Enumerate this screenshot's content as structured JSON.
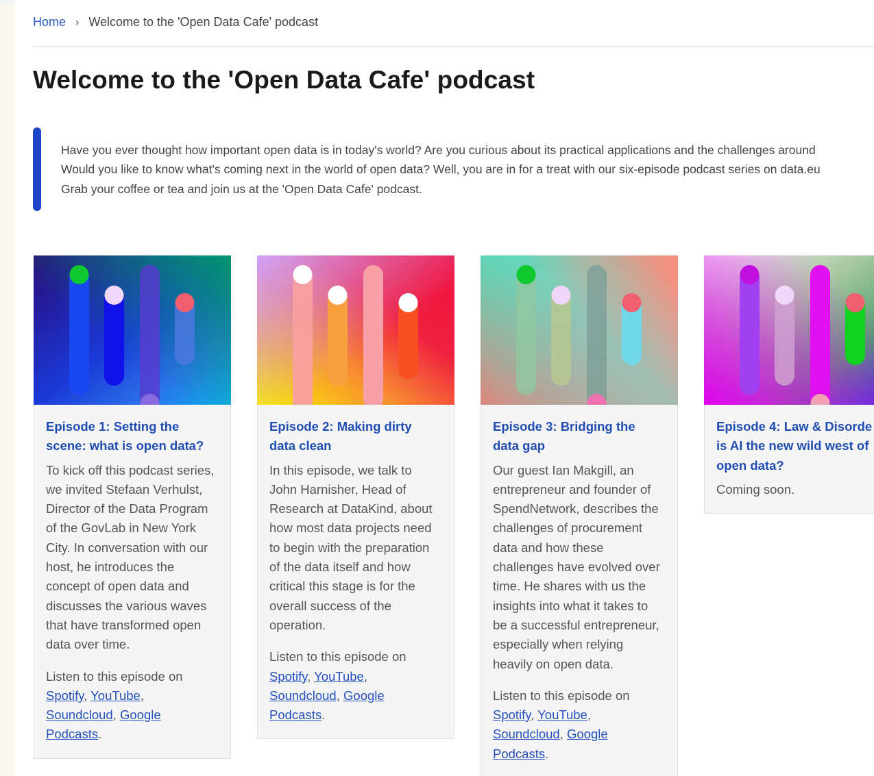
{
  "breadcrumb": {
    "home": "Home",
    "separator": "›",
    "current": "Welcome to the 'Open Data Cafe' podcast"
  },
  "page_title": "Welcome to the 'Open Data Cafe' podcast",
  "intro": {
    "lines": [
      "Have you ever thought how important open data is in today's world? Are you curious about its practical applications and the challenges around",
      "Would you like to know what's coming next in the world of open data? Well, you are in for a treat with our six-episode podcast series on data.eu",
      "Grab your coffee or tea and join us at the 'Open Data Cafe' podcast."
    ]
  },
  "cards": [
    {
      "title_lines": [
        "Episode 1: Setting the",
        "scene: what is open data?"
      ],
      "desc_lines": [
        "To kick off this podcast series,",
        "we invited Stefaan Verhulst,",
        "Director of the Data Program",
        "of the GovLab in New York",
        "City. In conversation with our",
        "host, he introduces the",
        "concept of open data and",
        "discusses the various waves",
        "that have transformed open",
        "data over time."
      ],
      "listen_label": "Listen to this episode on",
      "links": {
        "spotify": "Spotify",
        "youtube": "YouTube",
        "soundcloud": "Soundcloud",
        "google": "Google",
        "podcasts": "Podcasts"
      }
    },
    {
      "title_lines": [
        "Episode 2: Making dirty",
        "data clean"
      ],
      "desc_lines": [
        "In this episode, we talk to",
        "John Harnisher, Head of",
        "Research at DataKind, about",
        "how most data projects need",
        "to begin with the preparation",
        "of the data itself and how",
        "critical this stage is for the",
        "overall success of the",
        "operation."
      ],
      "listen_label": "Listen to this episode on",
      "links": {
        "spotify": "Spotify",
        "youtube": "YouTube",
        "soundcloud": "Soundcloud",
        "google": "Google",
        "podcasts": "Podcasts"
      }
    },
    {
      "title_lines": [
        "Episode 3: Bridging the",
        "data gap"
      ],
      "desc_lines": [
        "Our guest Ian Makgill, an",
        "entrepreneur and founder of",
        "SpendNetwork, describes the",
        "challenges of procurement",
        "data and how these",
        "challenges have evolved over",
        "time. He shares with us the",
        "insights into what it takes to",
        "be a successful entrepreneur,",
        "especially when relying",
        "heavily on open data."
      ],
      "listen_label": "Listen to this episode on",
      "links": {
        "spotify": "Spotify",
        "youtube": "YouTube",
        "soundcloud": "Soundcloud",
        "google": "Google",
        "podcasts": "Podcasts"
      }
    },
    {
      "title_lines": [
        "Episode 4: Law & Disorde",
        "is AI the new wild west of",
        "open data?"
      ],
      "desc_lines": [
        "Coming soon."
      ]
    }
  ],
  "colors": {
    "link": "#2d5cbf",
    "title": "#1a1a1a",
    "card_title": "#1f4db3",
    "accent_bar": "#1e45c8",
    "card_bg": "#f5f5f5"
  }
}
